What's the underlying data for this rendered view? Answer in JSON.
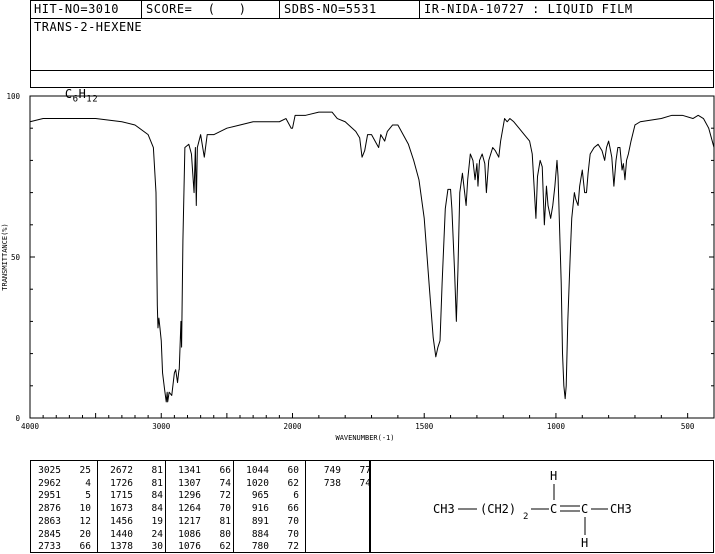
{
  "header": {
    "hit_no": "HIT-NO=3010",
    "score": "SCORE=  (   )",
    "sdbs_no": "SDBS-NO=5531",
    "ir_id": "IR-NIDA-10727 : LIQUID FILM",
    "compound_name": "TRANS-2-HEXENE",
    "formula_c": "C",
    "formula_c_sub": "6",
    "formula_h": "H",
    "formula_h_sub": "12"
  },
  "chart_data": {
    "type": "line",
    "xlabel": "WAVENUMBER(-1)",
    "ylabel": "TRANSMITTANCE(%)",
    "xlim": [
      4000,
      400
    ],
    "ylim": [
      0,
      100
    ],
    "x_ticks": [
      "4000",
      "3000",
      "2000",
      "1500",
      "1000",
      "500"
    ],
    "y_ticks": [
      "100",
      "50",
      "0"
    ],
    "series": [
      {
        "points": [
          [
            4000,
            92
          ],
          [
            3900,
            93
          ],
          [
            3700,
            93
          ],
          [
            3500,
            93
          ],
          [
            3300,
            92
          ],
          [
            3200,
            91
          ],
          [
            3100,
            88
          ],
          [
            3060,
            84
          ],
          [
            3040,
            70
          ],
          [
            3030,
            35
          ],
          [
            3025,
            28
          ],
          [
            3018,
            31
          ],
          [
            3010,
            28
          ],
          [
            3000,
            24
          ],
          [
            2990,
            14
          ],
          [
            2975,
            9
          ],
          [
            2962,
            5
          ],
          [
            2955,
            8
          ],
          [
            2951,
            5
          ],
          [
            2940,
            8
          ],
          [
            2920,
            7
          ],
          [
            2900,
            14
          ],
          [
            2890,
            15
          ],
          [
            2876,
            11
          ],
          [
            2865,
            15
          ],
          [
            2863,
            15
          ],
          [
            2850,
            30
          ],
          [
            2845,
            22
          ],
          [
            2835,
            55
          ],
          [
            2820,
            84
          ],
          [
            2790,
            85
          ],
          [
            2770,
            82
          ],
          [
            2750,
            70
          ],
          [
            2740,
            84
          ],
          [
            2733,
            66
          ],
          [
            2725,
            84
          ],
          [
            2700,
            88
          ],
          [
            2672,
            81
          ],
          [
            2650,
            88
          ],
          [
            2600,
            88
          ],
          [
            2500,
            90
          ],
          [
            2400,
            91
          ],
          [
            2300,
            92
          ],
          [
            2200,
            92
          ],
          [
            2100,
            92
          ],
          [
            2050,
            93
          ],
          [
            2010,
            90
          ],
          [
            2000,
            90
          ],
          [
            1990,
            94
          ],
          [
            1950,
            94
          ],
          [
            1900,
            95
          ],
          [
            1850,
            95
          ],
          [
            1830,
            93
          ],
          [
            1800,
            92
          ],
          [
            1760,
            89
          ],
          [
            1745,
            87
          ],
          [
            1736,
            81
          ],
          [
            1726,
            83
          ],
          [
            1715,
            88
          ],
          [
            1700,
            88
          ],
          [
            1680,
            85
          ],
          [
            1673,
            84
          ],
          [
            1665,
            88
          ],
          [
            1650,
            86
          ],
          [
            1640,
            89
          ],
          [
            1620,
            91
          ],
          [
            1600,
            91
          ],
          [
            1580,
            88
          ],
          [
            1560,
            85
          ],
          [
            1540,
            80
          ],
          [
            1520,
            74
          ],
          [
            1500,
            62
          ],
          [
            1480,
            40
          ],
          [
            1466,
            25
          ],
          [
            1456,
            19
          ],
          [
            1448,
            22
          ],
          [
            1440,
            24
          ],
          [
            1432,
            42
          ],
          [
            1420,
            65
          ],
          [
            1410,
            71
          ],
          [
            1400,
            71
          ],
          [
            1395,
            65
          ],
          [
            1385,
            46
          ],
          [
            1378,
            30
          ],
          [
            1372,
            46
          ],
          [
            1365,
            70
          ],
          [
            1355,
            76
          ],
          [
            1341,
            66
          ],
          [
            1335,
            74
          ],
          [
            1325,
            82
          ],
          [
            1315,
            80
          ],
          [
            1307,
            74
          ],
          [
            1300,
            79
          ],
          [
            1296,
            72
          ],
          [
            1290,
            80
          ],
          [
            1280,
            82
          ],
          [
            1270,
            79
          ],
          [
            1264,
            70
          ],
          [
            1255,
            80
          ],
          [
            1240,
            84
          ],
          [
            1230,
            83
          ],
          [
            1217,
            81
          ],
          [
            1210,
            86
          ],
          [
            1195,
            93
          ],
          [
            1185,
            92
          ],
          [
            1175,
            93
          ],
          [
            1160,
            92
          ],
          [
            1140,
            90
          ],
          [
            1120,
            88
          ],
          [
            1100,
            86
          ],
          [
            1090,
            82
          ],
          [
            1076,
            62
          ],
          [
            1070,
            75
          ],
          [
            1060,
            80
          ],
          [
            1052,
            78
          ],
          [
            1044,
            60
          ],
          [
            1036,
            72
          ],
          [
            1030,
            66
          ],
          [
            1020,
            62
          ],
          [
            1012,
            66
          ],
          [
            1004,
            72
          ],
          [
            996,
            80
          ],
          [
            992,
            75
          ],
          [
            980,
            42
          ],
          [
            975,
            20
          ],
          [
            970,
            10
          ],
          [
            965,
            6
          ],
          [
            961,
            10
          ],
          [
            955,
            30
          ],
          [
            946,
            50
          ],
          [
            940,
            62
          ],
          [
            930,
            70
          ],
          [
            925,
            68
          ],
          [
            916,
            66
          ],
          [
            910,
            72
          ],
          [
            900,
            77
          ],
          [
            891,
            70
          ],
          [
            884,
            70
          ],
          [
            878,
            76
          ],
          [
            870,
            82
          ],
          [
            855,
            84
          ],
          [
            840,
            85
          ],
          [
            825,
            83
          ],
          [
            815,
            80
          ],
          [
            808,
            84
          ],
          [
            800,
            86
          ],
          [
            795,
            84
          ],
          [
            788,
            81
          ],
          [
            780,
            72
          ],
          [
            772,
            80
          ],
          [
            765,
            84
          ],
          [
            757,
            84
          ],
          [
            749,
            77
          ],
          [
            744,
            79
          ],
          [
            738,
            74
          ],
          [
            732,
            80
          ],
          [
            725,
            82
          ],
          [
            715,
            86
          ],
          [
            700,
            91
          ],
          [
            680,
            92
          ],
          [
            600,
            93
          ],
          [
            560,
            94
          ],
          [
            520,
            94
          ],
          [
            480,
            93
          ],
          [
            460,
            94
          ],
          [
            440,
            93
          ],
          [
            420,
            90
          ],
          [
            400,
            84
          ]
        ]
      }
    ]
  },
  "peak_table": {
    "columns": [
      [
        [
          "3025",
          "25"
        ],
        [
          "2962",
          "4"
        ],
        [
          "2951",
          "5"
        ],
        [
          "2876",
          "10"
        ],
        [
          "2863",
          "12"
        ],
        [
          "2845",
          "20"
        ],
        [
          "2733",
          "66"
        ]
      ],
      [
        [
          "2672",
          "81"
        ],
        [
          "1726",
          "81"
        ],
        [
          "1715",
          "84"
        ],
        [
          "1673",
          "84"
        ],
        [
          "1456",
          "19"
        ],
        [
          "1440",
          "24"
        ],
        [
          "1378",
          "30"
        ]
      ],
      [
        [
          "1341",
          "66"
        ],
        [
          "1307",
          "74"
        ],
        [
          "1296",
          "72"
        ],
        [
          "1264",
          "70"
        ],
        [
          "1217",
          "81"
        ],
        [
          "1086",
          "80"
        ],
        [
          "1076",
          "62"
        ]
      ],
      [
        [
          "1044",
          "60"
        ],
        [
          "1020",
          "62"
        ],
        [
          "965",
          "6"
        ],
        [
          "916",
          "66"
        ],
        [
          "891",
          "70"
        ],
        [
          "884",
          "70"
        ],
        [
          "780",
          "72"
        ]
      ],
      [
        [
          "749",
          "77"
        ],
        [
          "738",
          "74"
        ]
      ]
    ]
  },
  "structure": {
    "left_group": "CH3",
    "chain_open": "(CH2)",
    "chain_sub": "2",
    "c1": "C",
    "c2": "C",
    "right_group": "CH3",
    "h_top": "H",
    "h_bottom": "H"
  }
}
